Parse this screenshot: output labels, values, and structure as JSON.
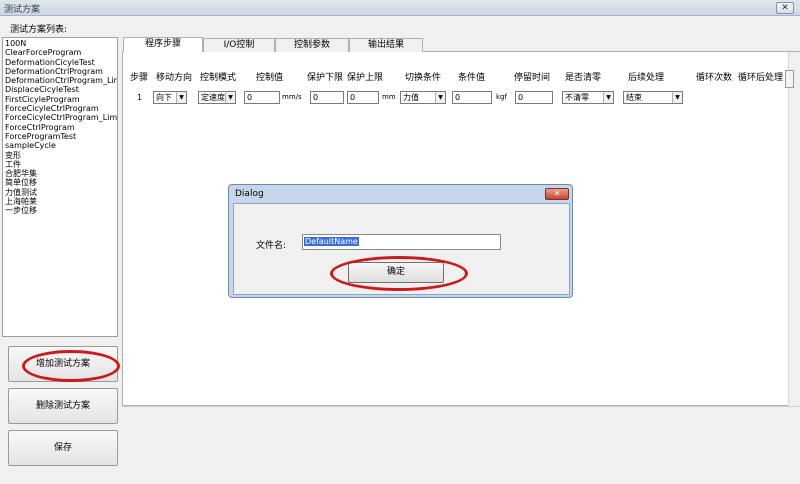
{
  "window": {
    "title": "测试方案",
    "close_glyph": "✕"
  },
  "plan_list": {
    "title": "测试方案列表:",
    "items": [
      "100N",
      "ClearForceProgram",
      "DeformationCicyleTest",
      "DeformationCtrlProgram",
      "DeformationCtrlProgram_Limit",
      "DisplaceCicyleTest",
      "FirstCicyleProgram",
      "ForceCicyleCtrlProgram",
      "ForceCicyleCtrlProgram_Limit",
      "ForceCtrlProgram",
      "ForceProgramTest",
      "sampleCycle",
      "变形",
      "工件",
      "合肥华集",
      "简单位移",
      "力值测试",
      "上海帕莱",
      "一步位移"
    ]
  },
  "buttons": {
    "add": "增加测试方案",
    "delete": "删除测试方案",
    "save": "保存"
  },
  "tabs": [
    "程序步骤",
    "I/O控制",
    "控制参数",
    "输出结果"
  ],
  "table": {
    "headers": [
      "步骤",
      "移动方向",
      "控制模式",
      "控制值",
      "保护下限",
      "保护上限",
      "切换条件",
      "条件值",
      "停留时间",
      "是否清零",
      "后续处理",
      "循环次数",
      "循环后处理"
    ],
    "row": {
      "step": "1",
      "direction": "向下",
      "mode": "定速度",
      "control_value": "0",
      "control_unit": "mm/s",
      "lower_limit": "0",
      "upper_limit": "0",
      "limit_unit": "mm",
      "switch_cond": "力值",
      "cond_value": "0",
      "cond_unit": "kgf",
      "dwell": "0",
      "clear": "不清零",
      "follow": "结束"
    }
  },
  "dialog": {
    "title": "Dialog",
    "close_glyph": "✕",
    "label": "文件名:",
    "value": "DefaultName",
    "ok": "确定"
  },
  "colors": {
    "annotation": "#cc1a1a",
    "selection": "#3a6ed8"
  }
}
